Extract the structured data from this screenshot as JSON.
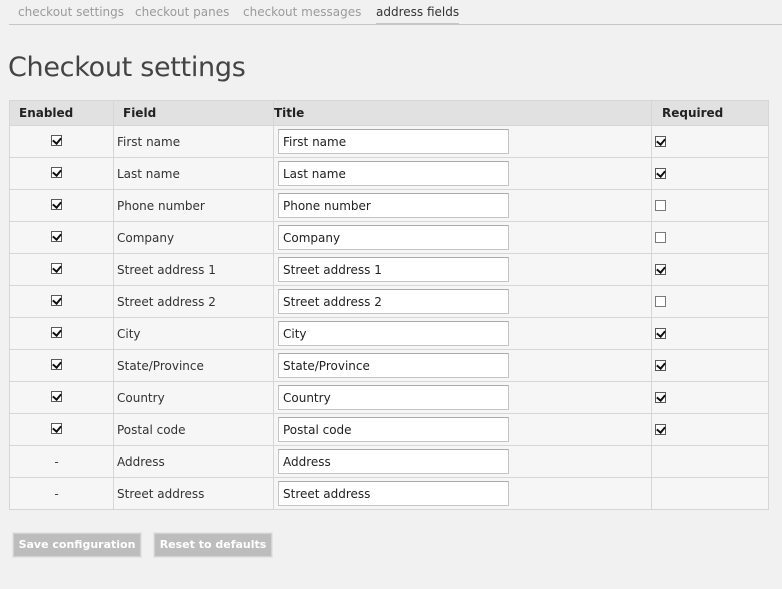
{
  "tabs": [
    {
      "label": "checkout settings"
    },
    {
      "label": "checkout panes"
    },
    {
      "label": "checkout messages"
    },
    {
      "label": "address fields"
    }
  ],
  "page_title": "Checkout settings",
  "table": {
    "headers": {
      "enabled": "Enabled",
      "field": "Field",
      "title": "Title",
      "required": "Required"
    },
    "rows": [
      {
        "enabled": true,
        "field": "First name",
        "title": "First name",
        "required": true
      },
      {
        "enabled": true,
        "field": "Last name",
        "title": "Last name",
        "required": true
      },
      {
        "enabled": true,
        "field": "Phone number",
        "title": "Phone number",
        "required": false
      },
      {
        "enabled": true,
        "field": "Company",
        "title": "Company",
        "required": false
      },
      {
        "enabled": true,
        "field": "Street address 1",
        "title": "Street address 1",
        "required": true
      },
      {
        "enabled": true,
        "field": "Street address 2",
        "title": "Street address 2",
        "required": false
      },
      {
        "enabled": true,
        "field": "City",
        "title": "City",
        "required": true
      },
      {
        "enabled": true,
        "field": "State/Province",
        "title": "State/Province",
        "required": true
      },
      {
        "enabled": true,
        "field": "Country",
        "title": "Country",
        "required": true
      },
      {
        "enabled": true,
        "field": "Postal code",
        "title": "Postal code",
        "required": true
      },
      {
        "enabled": "-",
        "field": "Address",
        "title": "Address",
        "required": null
      },
      {
        "enabled": "-",
        "field": "Street address",
        "title": "Street address",
        "required": null
      }
    ]
  },
  "buttons": {
    "save": "Save configuration",
    "reset": "Reset to defaults"
  }
}
